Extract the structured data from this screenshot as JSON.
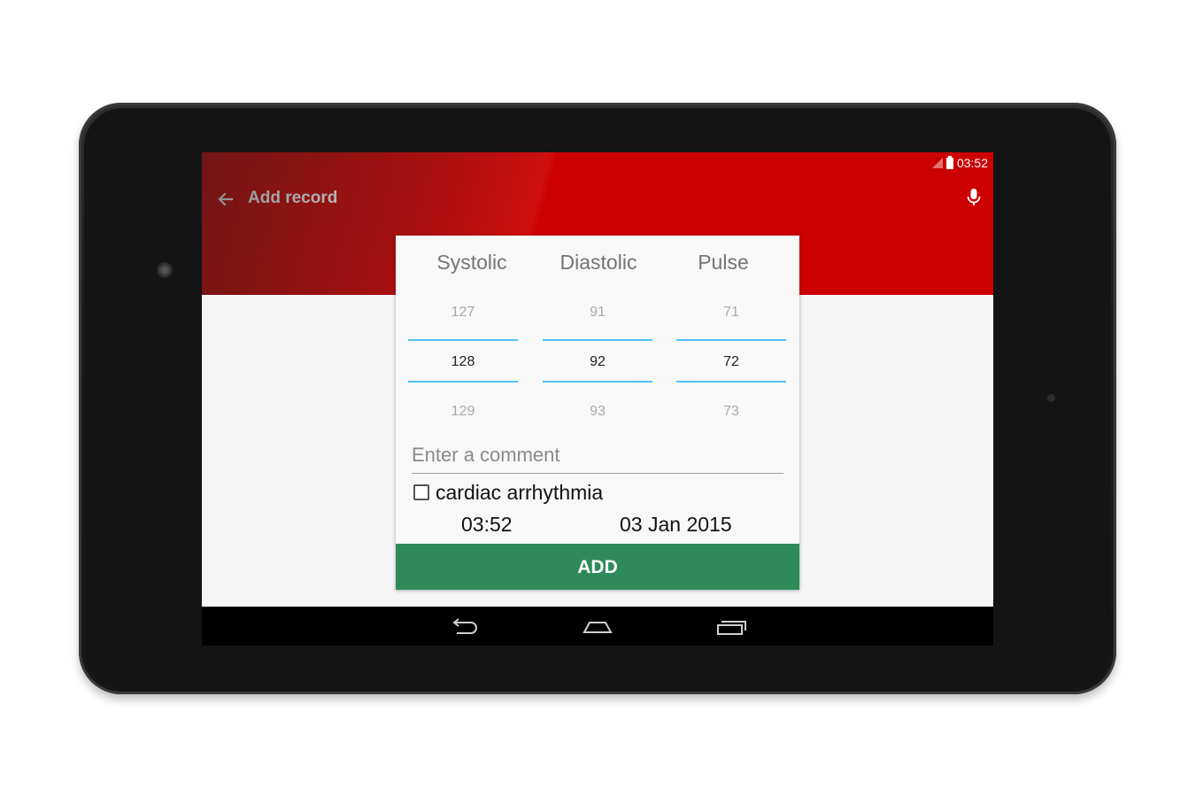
{
  "status_bar": {
    "time": "03:52"
  },
  "toolbar": {
    "title": "Add record"
  },
  "columns": {
    "systolic": {
      "label": "Systolic",
      "prev": "127",
      "current": "128",
      "next": "129"
    },
    "diastolic": {
      "label": "Diastolic",
      "prev": "91",
      "current": "92",
      "next": "93"
    },
    "pulse": {
      "label": "Pulse",
      "prev": "71",
      "current": "72",
      "next": "73"
    }
  },
  "comment": {
    "placeholder": "Enter a comment",
    "value": ""
  },
  "arrhythmia": {
    "label": "cardiac arrhythmia",
    "checked": false
  },
  "datetime": {
    "time": "03:52",
    "date": "03 Jan 2015"
  },
  "add_button": {
    "label": "ADD"
  },
  "icons": {
    "back": "arrow-left-icon",
    "mic": "microphone-icon",
    "nav_back": "nav-back-icon",
    "nav_home": "nav-home-icon",
    "nav_recents": "nav-recents-icon"
  },
  "colors": {
    "appbar": "#cc0000",
    "add_button": "#2e8b57",
    "picker_line": "#4fc3f7"
  }
}
